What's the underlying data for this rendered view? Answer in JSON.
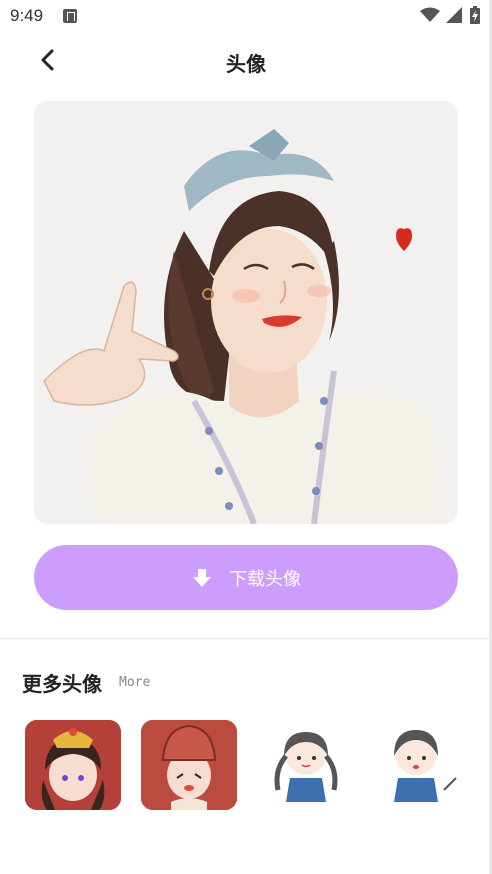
{
  "status_bar": {
    "time": "9:49"
  },
  "header": {
    "title": "头像"
  },
  "download": {
    "label": "下载头像"
  },
  "more": {
    "title": "更多头像",
    "subtitle": "More"
  },
  "colors": {
    "accent": "#cc9dff",
    "title_text": "#222222",
    "sub_text": "#888888"
  },
  "icons": {
    "back": "chevron-left-icon",
    "download": "download-arrow-icon",
    "wifi": "wifi-icon",
    "signal": "signal-icon",
    "battery": "battery-icon"
  }
}
